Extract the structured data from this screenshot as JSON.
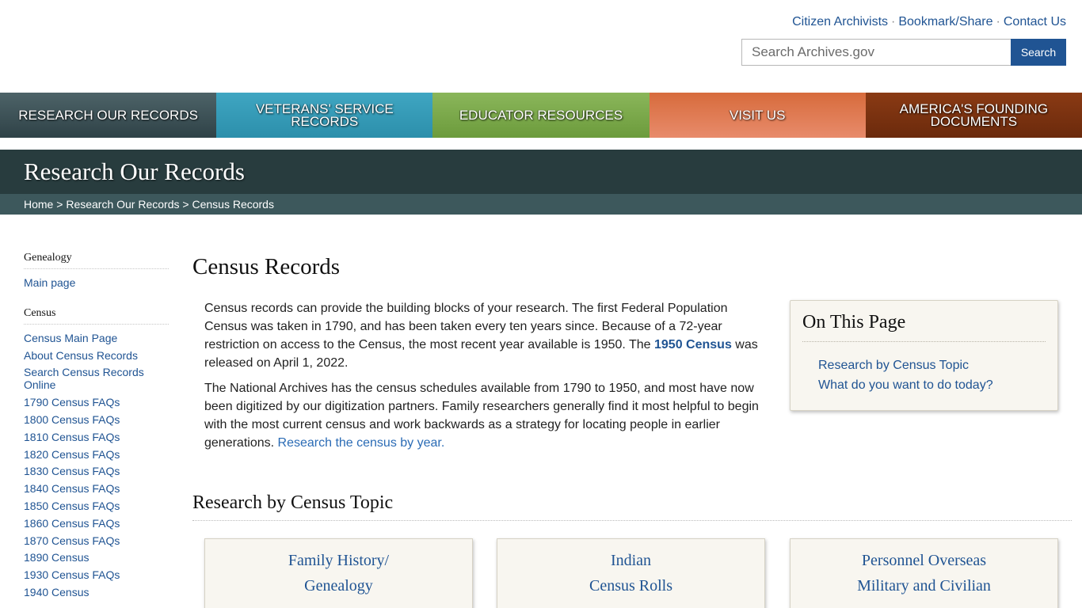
{
  "utility": {
    "links": [
      "Citizen Archivists",
      "Bookmark/Share",
      "Contact Us"
    ],
    "separator": "·"
  },
  "search": {
    "placeholder": "Search Archives.gov",
    "button_label": "Search"
  },
  "nav": {
    "items": [
      {
        "label": "RESEARCH OUR RECORDS",
        "color": "#3e5257"
      },
      {
        "label": "VETERANS' SERVICE RECORDS",
        "color": "#379bb8"
      },
      {
        "label": "EDUCATOR RESOURCES",
        "color": "#7ba94b"
      },
      {
        "label": "VISIT US",
        "color": "#e07b52"
      },
      {
        "label": "AMERICA'S FOUNDING DOCUMENTS",
        "color": "#7a3210"
      }
    ]
  },
  "banner": {
    "title": "Research Our Records",
    "breadcrumb": [
      "Home",
      "Research Our Records",
      "Census Records"
    ],
    "breadcrumb_sep": ">"
  },
  "sidebar": {
    "sections": [
      {
        "heading": "Genealogy",
        "links": [
          "Main page"
        ]
      },
      {
        "heading": "Census",
        "links": [
          "Census Main Page",
          "About Census Records",
          "Search Census Records Online",
          "1790 Census FAQs",
          "1800 Census FAQs",
          "1810 Census FAQs",
          "1820 Census FAQs",
          "1830 Census FAQs",
          "1840 Census FAQs",
          "1850 Census FAQs",
          "1860 Census FAQs",
          "1870 Census FAQs",
          "1890 Census",
          "1930 Census FAQs",
          "1940 Census"
        ]
      }
    ]
  },
  "main": {
    "title": "Census Records",
    "p1_a": "Census records can provide the building blocks of your research.  The first Federal Population Census was taken in 1790, and has been taken every ten years since.  Because of a 72-year restriction on access to the Census, the most recent year available is 1950. The ",
    "p1_link": "1950 Census",
    "p1_b": " was released on April 1, 2022.",
    "p2_a": "The National Archives has the census schedules available from 1790 to 1950, and most have now been digitized by our digitization partners. Family researchers generally find it most helpful to begin with the most current census and work backwards as a strategy for locating people in earlier generations. ",
    "p2_link": "Research the census by year.",
    "on_this_page": {
      "title": "On This Page",
      "links": [
        "Research by Census Topic",
        "What do you want to do today?"
      ]
    },
    "topic_heading": "Research by Census Topic",
    "cards": [
      {
        "line1": "Family History/",
        "line2": "Genealogy"
      },
      {
        "line1": "Indian",
        "line2": "Census Rolls"
      },
      {
        "line1": "Personnel Overseas",
        "line2": "Military and Civilian"
      }
    ]
  }
}
